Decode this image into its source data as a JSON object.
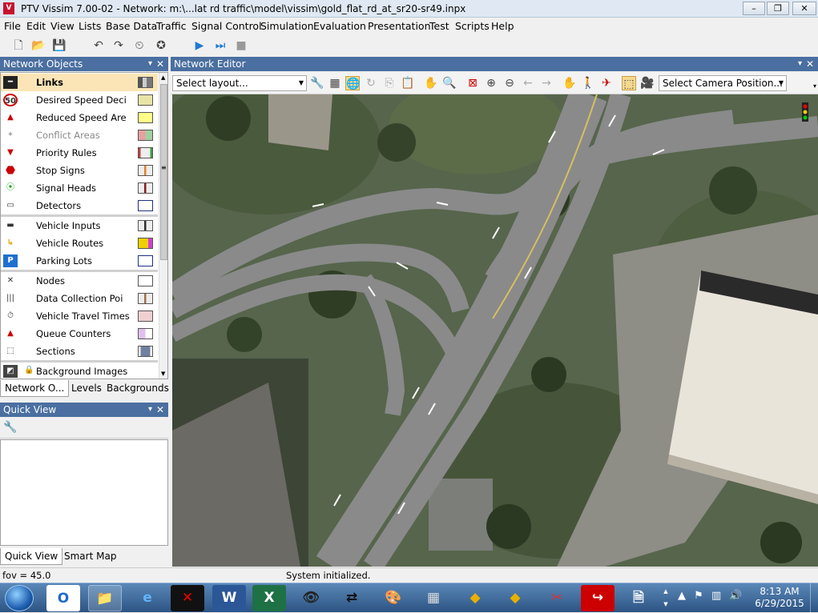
{
  "window": {
    "app_icon": "vissim-icon",
    "title": "PTV Vissim 7.00-02 - Network: m:\\...lat rd traffic\\model\\vissim\\gold_flat_rd_at_sr20-sr49.inpx",
    "min": "–",
    "max": "❐",
    "close": "✕"
  },
  "menu": [
    "File",
    "Edit",
    "View",
    "Lists",
    "Base Data",
    "Traffic",
    "Signal Control",
    "Simulation",
    "Evaluation",
    "Presentation",
    "Test",
    "Scripts",
    "Help"
  ],
  "toolbar_icons": [
    "new-file-icon",
    "open-folder-icon",
    "save-icon",
    "undo-icon",
    "redo-icon",
    "stopwatch-icon",
    "star-icon",
    "run-icon",
    "step-icon",
    "stop-icon"
  ],
  "network_objects": {
    "title": "Network Objects",
    "pin": "📌",
    "close": "✕",
    "items": [
      {
        "label": "Links",
        "icon": "links-icon",
        "glyph": "━",
        "selected": true,
        "swatch": "#9a9a9a"
      },
      {
        "label": "Desired Speed Deci",
        "icon": "speed-50-icon",
        "glyph": "50",
        "swatch": "#e8e4a8"
      },
      {
        "label": "Reduced Speed Are",
        "icon": "reduced-speed-icon",
        "glyph": "▲",
        "swatch": "#ffff88"
      },
      {
        "label": "Conflict Areas",
        "icon": "conflict-areas-icon",
        "glyph": "✦",
        "dim": true,
        "swatch": "#e8a0a0"
      },
      {
        "label": "Priority Rules",
        "icon": "priority-rules-icon",
        "glyph": "▼",
        "swatch": "#c04040"
      },
      {
        "label": "Stop Signs",
        "icon": "stop-sign-icon",
        "glyph": "⬣",
        "swatch": "#e08030"
      },
      {
        "label": "Signal Heads",
        "icon": "signal-head-icon",
        "glyph": "⦿",
        "swatch": "#802020"
      },
      {
        "label": "Detectors",
        "icon": "detector-icon",
        "glyph": "▭",
        "swatch": "#ffffff"
      },
      {
        "label": "Vehicle Inputs",
        "icon": "vehicle-input-icon",
        "glyph": "🚗",
        "swatch": "#303030"
      },
      {
        "label": "Vehicle Routes",
        "icon": "vehicle-route-icon",
        "glyph": "↳",
        "swatch": "#f0d000"
      },
      {
        "label": "Parking Lots",
        "icon": "parking-icon",
        "glyph": "P",
        "swatch": "#ffffff"
      },
      {
        "label": "Nodes",
        "icon": "nodes-icon",
        "glyph": "✕",
        "swatch": "#ffffff"
      },
      {
        "label": "Data Collection Poi",
        "icon": "data-collection-icon",
        "glyph": "|||",
        "swatch": "#c0a080"
      },
      {
        "label": "Vehicle Travel Times",
        "icon": "travel-time-icon",
        "glyph": "⏱",
        "swatch": "#f0c0c0"
      },
      {
        "label": "Queue Counters",
        "icon": "queue-counter-icon",
        "glyph": "▲",
        "swatch": "#e0c0f0"
      },
      {
        "label": "Sections",
        "icon": "sections-icon",
        "glyph": "⬚",
        "swatch": "#7080a0"
      },
      {
        "label": "Background Images",
        "icon": "background-image-icon",
        "glyph": "◩",
        "locked": true
      }
    ],
    "tabs": [
      "Network O...",
      "Levels",
      "Backgrounds"
    ]
  },
  "quick_view": {
    "title": "Quick View",
    "pin": "📌",
    "close": "✕",
    "tool_icon": "wrench-icon",
    "tabs": [
      "Quick View",
      "Smart Map"
    ]
  },
  "network_editor": {
    "title": "Network Editor",
    "pin": "📌",
    "close": "✕",
    "layout_placeholder": "Select layout...",
    "camera_placeholder": "Select Camera Position...",
    "toolbar_icons": [
      "wrench-icon",
      "grid-icon",
      "globe-icon",
      "rotate-icon",
      "copy-icon",
      "paste-icon",
      "pan-hand-icon",
      "zoom-find-icon",
      "zoom-all-icon",
      "zoom-in-icon",
      "zoom-out-icon",
      "back-icon",
      "forward-icon",
      "hand-icon",
      "pedestrian-icon",
      "no-plane-icon",
      "3d-cube-icon",
      "camera-icon"
    ]
  },
  "status": {
    "left": "fov = 45.0",
    "center": "System initialized."
  },
  "taskbar": {
    "items": [
      "start-orb",
      "outlook-icon",
      "explorer-icon",
      "ie-icon",
      "x-app-icon",
      "word-icon",
      "excel-icon",
      "vissim-viewer-icon",
      "sync-arrows-icon",
      "paint-icon",
      "calculator-icon",
      "traffic-app-icon",
      "traffic-app2-icon",
      "snipping-icon",
      "pdf-icon",
      "document-icon"
    ],
    "time": "8:13 AM",
    "date": "6/29/2015"
  }
}
